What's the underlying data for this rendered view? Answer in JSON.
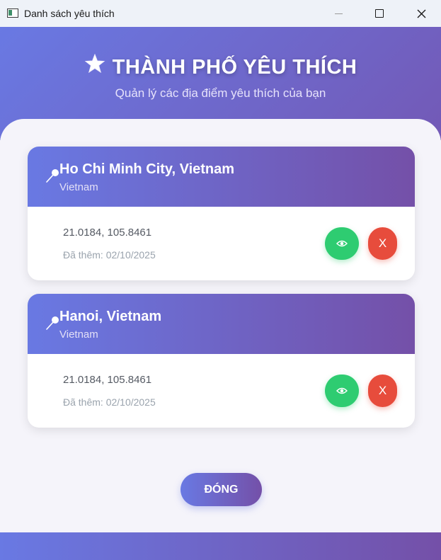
{
  "window": {
    "title": "Danh sách yêu thích"
  },
  "header": {
    "icon": "star-icon",
    "title": "THÀNH PHỐ YÊU THÍCH",
    "subtitle": "Quản lý các địa điểm yêu thích của bạn"
  },
  "favorites": [
    {
      "name": "Ho Chi Minh City, Vietnam",
      "country": "Vietnam",
      "coords": "21.0184, 105.8461",
      "added": "Đã thêm: 02/10/2025",
      "view_icon": "eye-icon",
      "delete_label": "X"
    },
    {
      "name": "Hanoi, Vietnam",
      "country": "Vietnam",
      "coords": "21.0184, 105.8461",
      "added": "Đã thêm: 02/10/2025",
      "view_icon": "eye-icon",
      "delete_label": "X"
    }
  ],
  "actions": {
    "close_label": "ĐÓNG"
  },
  "colors": {
    "accent_start": "#6979e3",
    "accent_end": "#7450a8",
    "view_button": "#2ecc71",
    "delete_button": "#e74c3c"
  }
}
